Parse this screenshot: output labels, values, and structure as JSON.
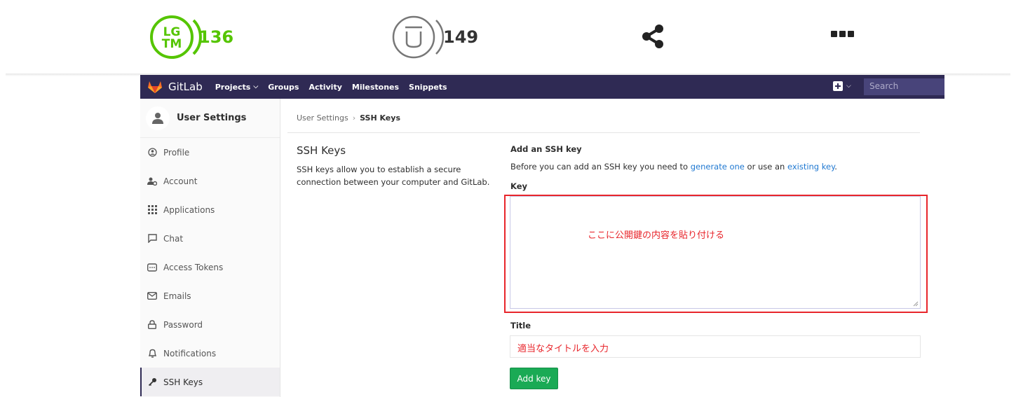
{
  "qiita": {
    "lgtm_count": "136",
    "stock_count": "149",
    "lgtm_icon": "lgtm-icon",
    "stock_icon": "stock-icon",
    "share_icon": "share-icon",
    "more_icon": "more-icon",
    "brand_color": "#55c500"
  },
  "gitlab": {
    "brand": "GitLab",
    "nav": [
      "Projects",
      "Groups",
      "Activity",
      "Milestones",
      "Snippets"
    ],
    "search_placeholder": "Search",
    "nav_color": "#2f2a54",
    "sidebar": {
      "title": "User Settings",
      "items": [
        {
          "label": "Profile",
          "icon": "profile-icon"
        },
        {
          "label": "Account",
          "icon": "account-icon"
        },
        {
          "label": "Applications",
          "icon": "applications-icon"
        },
        {
          "label": "Chat",
          "icon": "chat-icon"
        },
        {
          "label": "Access Tokens",
          "icon": "access-tokens-icon"
        },
        {
          "label": "Emails",
          "icon": "email-icon"
        },
        {
          "label": "Password",
          "icon": "lock-icon"
        },
        {
          "label": "Notifications",
          "icon": "bell-icon"
        },
        {
          "label": "SSH Keys",
          "icon": "key-icon"
        }
      ],
      "active": "SSH Keys"
    },
    "breadcrumb": {
      "parent": "User Settings",
      "current": "SSH Keys"
    },
    "section": {
      "title": "SSH Keys",
      "description": "SSH keys allow you to establish a secure connection between your computer and GitLab."
    },
    "form": {
      "heading": "Add an SSH key",
      "intro_before": "Before you can add an SSH key you need to ",
      "link1": "generate one",
      "intro_middle": " or use an ",
      "link2": "existing key",
      "intro_after": ".",
      "key_label": "Key",
      "key_annotation": "ここに公開鍵の内容を貼り付ける",
      "title_label": "Title",
      "title_annotation": "適当なタイトルを入力",
      "submit": "Add key",
      "submit_color": "#1aaa55",
      "annotation_color": "#e8252b"
    }
  }
}
